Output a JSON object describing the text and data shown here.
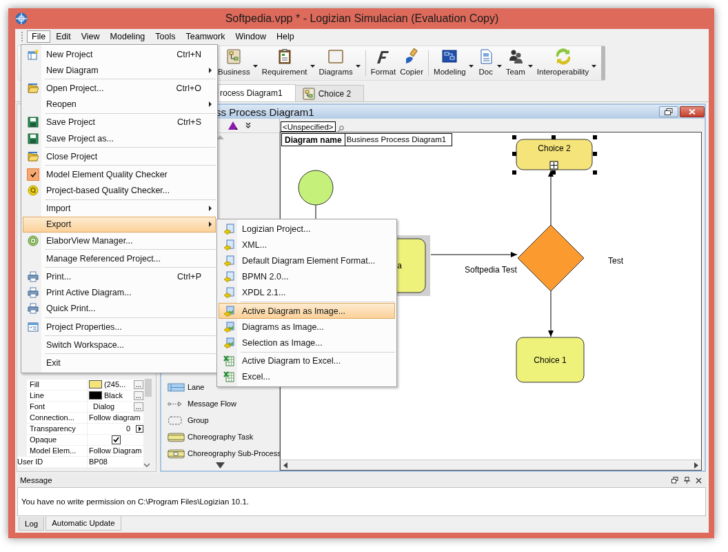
{
  "window": {
    "title": "Softpedia.vpp * - Logizian Simulacian (Evaluation Copy)"
  },
  "menubar": [
    {
      "label": "File",
      "selected": true
    },
    {
      "label": "Edit",
      "selected": false
    },
    {
      "label": "View",
      "selected": false
    },
    {
      "label": "Modeling",
      "selected": false
    },
    {
      "label": "Tools",
      "selected": false
    },
    {
      "label": "Teamwork",
      "selected": false
    },
    {
      "label": "Window",
      "selected": false
    },
    {
      "label": "Help",
      "selected": false
    }
  ],
  "toolbar": [
    {
      "label": "Business",
      "kind": "business",
      "dropdown": true
    },
    {
      "label": "Requirement",
      "kind": "requirement",
      "dropdown": true
    },
    {
      "label": "Diagrams",
      "kind": "diagrams",
      "dropdown": true
    },
    {
      "kind": "separator"
    },
    {
      "label": "Format",
      "kind": "format",
      "dropdown": false
    },
    {
      "label": "Copier",
      "kind": "copier",
      "dropdown": false
    },
    {
      "kind": "separator"
    },
    {
      "label": "Modeling",
      "kind": "modeling",
      "dropdown": true
    },
    {
      "label": "Doc",
      "kind": "doc",
      "dropdown": true
    },
    {
      "label": "Team",
      "kind": "team",
      "dropdown": true
    },
    {
      "label": "Interoperability",
      "kind": "interop",
      "dropdown": true
    }
  ],
  "tabs": [
    {
      "label": "rocess Diagram1",
      "selected": true
    },
    {
      "label": "Choice 2",
      "selected": false
    }
  ],
  "diagram_window": {
    "title": "ss Process Diagram1"
  },
  "palette": {
    "items": [
      {
        "label": "Lane",
        "kind": "lane"
      },
      {
        "label": "Message Flow",
        "kind": "message_flow"
      },
      {
        "label": "Group",
        "kind": "group"
      },
      {
        "label": "Choreography Task",
        "kind": "choreography_task"
      },
      {
        "label": "Choreography Sub-Process",
        "kind": "choreography_subprocess"
      }
    ]
  },
  "canvas": {
    "filter": "<Unspecified>",
    "diagram_name_label": "Diagram name",
    "diagram_name": "Business Process Diagram1",
    "nodes": [
      {
        "kind": "start"
      },
      {
        "kind": "task",
        "label": "a",
        "selected": false
      },
      {
        "kind": "gateway"
      },
      {
        "kind": "task",
        "label": "Choice 2",
        "selected": true
      },
      {
        "kind": "task",
        "label": "Choice 1",
        "selected": false
      }
    ],
    "edge_labels": [
      "Softpedia Test",
      "Test"
    ]
  },
  "properties": [
    {
      "name": "Fill",
      "kind": "color",
      "color": "#f5e47a",
      "value": "(245...",
      "button": "..."
    },
    {
      "name": "Line",
      "kind": "color",
      "color": "#000000",
      "value": "Black",
      "button": "..."
    },
    {
      "name": "Font",
      "kind": "text",
      "value": "Dialog",
      "button": "..."
    },
    {
      "name": "Connection...",
      "kind": "text",
      "value": "Follow diagram"
    },
    {
      "name": "Transparency",
      "kind": "spin",
      "value": "0"
    },
    {
      "name": "Opaque",
      "kind": "check",
      "checked": true
    },
    {
      "name": "Model Elem...",
      "kind": "text",
      "value": "Follow Diagram"
    },
    {
      "name": "User ID",
      "kind": "id",
      "value": "BP08"
    }
  ],
  "message_panel": {
    "title": "Message",
    "text": "You have no write permission on C:\\Program Files\\Logizian 10.1.",
    "tabs": [
      {
        "label": "Log",
        "selected": true
      },
      {
        "label": "Automatic Update",
        "selected": false
      }
    ]
  },
  "file_menu": [
    {
      "kind": "item",
      "label": "New Project",
      "shortcut": "Ctrl+N",
      "submenu": false,
      "checked": false,
      "selected": false
    },
    {
      "kind": "item",
      "label": "New Diagram",
      "submenu": true,
      "checked": false,
      "selected": false
    },
    {
      "kind": "separator"
    },
    {
      "kind": "item",
      "label": "Open Project...",
      "shortcut": "Ctrl+O",
      "submenu": false,
      "checked": false,
      "selected": false
    },
    {
      "kind": "item",
      "label": "Reopen",
      "submenu": true,
      "checked": false,
      "selected": false
    },
    {
      "kind": "separator"
    },
    {
      "kind": "item",
      "label": "Save Project",
      "shortcut": "Ctrl+S",
      "submenu": false,
      "checked": false,
      "selected": false
    },
    {
      "kind": "item",
      "label": "Save Project as...",
      "submenu": false,
      "checked": false,
      "selected": false
    },
    {
      "kind": "separator"
    },
    {
      "kind": "item",
      "label": "Close Project",
      "submenu": false,
      "checked": false,
      "selected": false
    },
    {
      "kind": "separator"
    },
    {
      "kind": "item",
      "label": "Model Element Quality Checker",
      "submenu": false,
      "checked": true,
      "selected": false
    },
    {
      "kind": "item",
      "label": "Project-based Quality Checker...",
      "submenu": false,
      "checked": false,
      "selected": false
    },
    {
      "kind": "separator"
    },
    {
      "kind": "item",
      "label": "Import",
      "submenu": true,
      "checked": false,
      "selected": false
    },
    {
      "kind": "item",
      "label": "Export",
      "submenu": true,
      "checked": false,
      "selected": true
    },
    {
      "kind": "item",
      "label": "ElaborView Manager...",
      "submenu": false,
      "checked": false,
      "selected": false
    },
    {
      "kind": "separator"
    },
    {
      "kind": "item",
      "label": "Manage Referenced Project...",
      "submenu": false,
      "checked": false,
      "selected": false
    },
    {
      "kind": "separator"
    },
    {
      "kind": "item",
      "label": "Print...",
      "shortcut": "Ctrl+P",
      "submenu": false,
      "checked": false,
      "selected": false
    },
    {
      "kind": "item",
      "label": "Print Active Diagram...",
      "submenu": false,
      "checked": false,
      "selected": false
    },
    {
      "kind": "item",
      "label": "Quick Print...",
      "submenu": false,
      "checked": false,
      "selected": false
    },
    {
      "kind": "separator"
    },
    {
      "kind": "item",
      "label": "Project Properties...",
      "submenu": false,
      "checked": false,
      "selected": false
    },
    {
      "kind": "separator"
    },
    {
      "kind": "item",
      "label": "Switch Workspace...",
      "submenu": false,
      "checked": false,
      "selected": false
    },
    {
      "kind": "separator"
    },
    {
      "kind": "item",
      "label": "Exit",
      "submenu": false,
      "checked": false,
      "selected": false
    }
  ],
  "export_submenu": [
    {
      "kind": "item",
      "label": "Logizian Project...",
      "selected": false
    },
    {
      "kind": "item",
      "label": "XML...",
      "selected": false
    },
    {
      "kind": "item",
      "label": "Default Diagram Element Format...",
      "selected": false
    },
    {
      "kind": "item",
      "label": "BPMN 2.0...",
      "selected": false
    },
    {
      "kind": "item",
      "label": "XPDL 2.1...",
      "selected": false
    },
    {
      "kind": "separator"
    },
    {
      "kind": "item",
      "label": "Active Diagram as Image...",
      "selected": true
    },
    {
      "kind": "item",
      "label": "Diagrams as Image...",
      "selected": false
    },
    {
      "kind": "item",
      "label": "Selection as Image...",
      "selected": false
    },
    {
      "kind": "separator"
    },
    {
      "kind": "item",
      "label": "Active Diagram to Excel...",
      "selected": false
    },
    {
      "kind": "item",
      "label": "Excel...",
      "selected": false
    }
  ]
}
